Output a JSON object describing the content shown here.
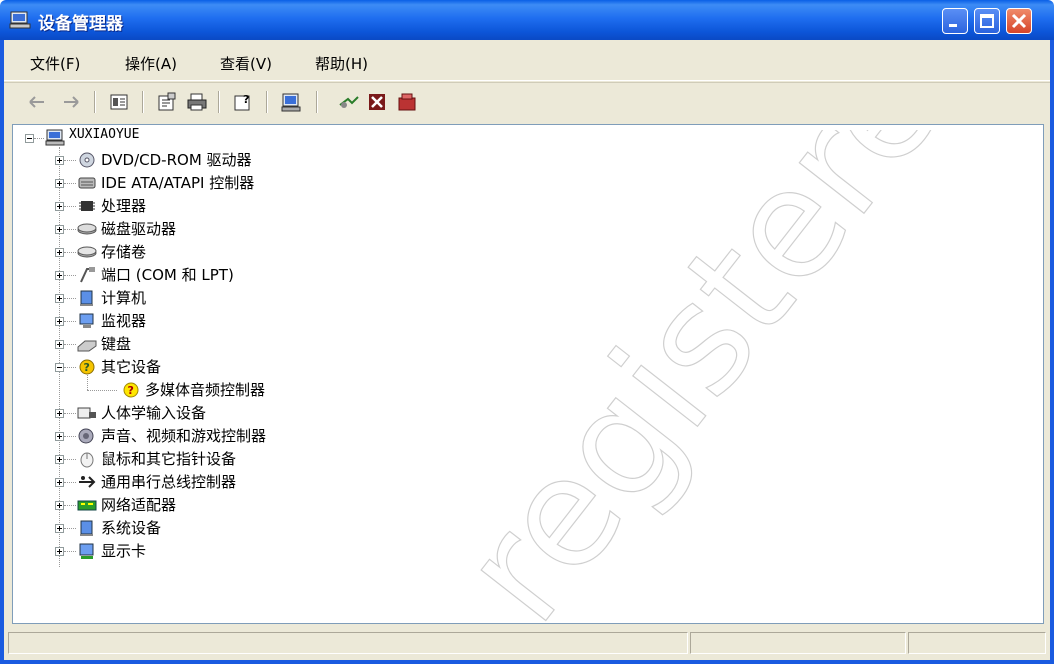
{
  "window": {
    "title": "设备管理器"
  },
  "menu": [
    {
      "label": "文件(F)"
    },
    {
      "label": "操作(A)"
    },
    {
      "label": "查看(V)"
    },
    {
      "label": "帮助(H)"
    }
  ],
  "toolbar": {
    "buttons": [
      "back-icon",
      "forward-icon",
      "view-icon",
      "properties-icon",
      "print-icon",
      "help-icon",
      "scan-icon",
      "update-driver-icon",
      "disable-icon",
      "uninstall-icon"
    ]
  },
  "tree": {
    "root": "XUXIAOYUE",
    "items": [
      {
        "label": "DVD/CD-ROM 驱动器",
        "icon": "cdrom-icon"
      },
      {
        "label": "IDE ATA/ATAPI 控制器",
        "icon": "ide-icon"
      },
      {
        "label": "处理器",
        "icon": "processor-icon"
      },
      {
        "label": "磁盘驱动器",
        "icon": "disk-icon"
      },
      {
        "label": "存储卷",
        "icon": "volume-icon"
      },
      {
        "label": "端口 (COM 和 LPT)",
        "icon": "port-icon"
      },
      {
        "label": "计算机",
        "icon": "computer-icon"
      },
      {
        "label": "监视器",
        "icon": "monitor-icon"
      },
      {
        "label": "键盘",
        "icon": "keyboard-icon"
      },
      {
        "label": "其它设备",
        "icon": "unknown-device-icon",
        "expanded": true
      },
      {
        "label": "多媒体音频控制器",
        "icon": "warning-device-icon",
        "child": true
      },
      {
        "label": "人体学输入设备",
        "icon": "hid-icon"
      },
      {
        "label": "声音、视频和游戏控制器",
        "icon": "sound-icon"
      },
      {
        "label": "鼠标和其它指针设备",
        "icon": "mouse-icon"
      },
      {
        "label": "通用串行总线控制器",
        "icon": "usb-icon"
      },
      {
        "label": "网络适配器",
        "icon": "network-icon"
      },
      {
        "label": "系统设备",
        "icon": "system-icon"
      },
      {
        "label": "显示卡",
        "icon": "display-icon"
      }
    ]
  },
  "colors": {
    "titlebar": "#0a5fe6",
    "frame": "#1a5be0",
    "chrome": "#ece9d8"
  }
}
